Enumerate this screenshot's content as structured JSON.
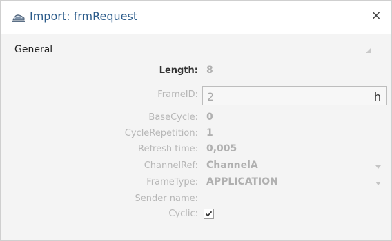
{
  "window": {
    "title": "Import: frmRequest",
    "icon": "ship-icon",
    "close_label": "×"
  },
  "section": {
    "label": "General",
    "toggle_icon": "collapse-triangle-icon"
  },
  "fields": {
    "length": {
      "label": "Length:",
      "value": "8"
    },
    "frame_id": {
      "label": "FrameID:",
      "value": "2",
      "unit": "h"
    },
    "base_cycle": {
      "label": "BaseCycle:",
      "value": "0"
    },
    "cycle_repetition": {
      "label": "CycleRepetition:",
      "value": "1"
    },
    "refresh_time": {
      "label": "Refresh time:",
      "value": "0,005"
    },
    "channel_ref": {
      "label": "ChannelRef:",
      "value": "ChannelA"
    },
    "frame_type": {
      "label": "FrameType:",
      "value": "APPLICATION"
    },
    "sender_name": {
      "label": "Sender name:",
      "value": ""
    },
    "cyclic": {
      "label": "Cyclic:",
      "checked": true
    }
  },
  "colors": {
    "title": "#2b5b8a",
    "disabled_text": "#b7b7b7",
    "panel_bg": "#f4f4f4"
  }
}
